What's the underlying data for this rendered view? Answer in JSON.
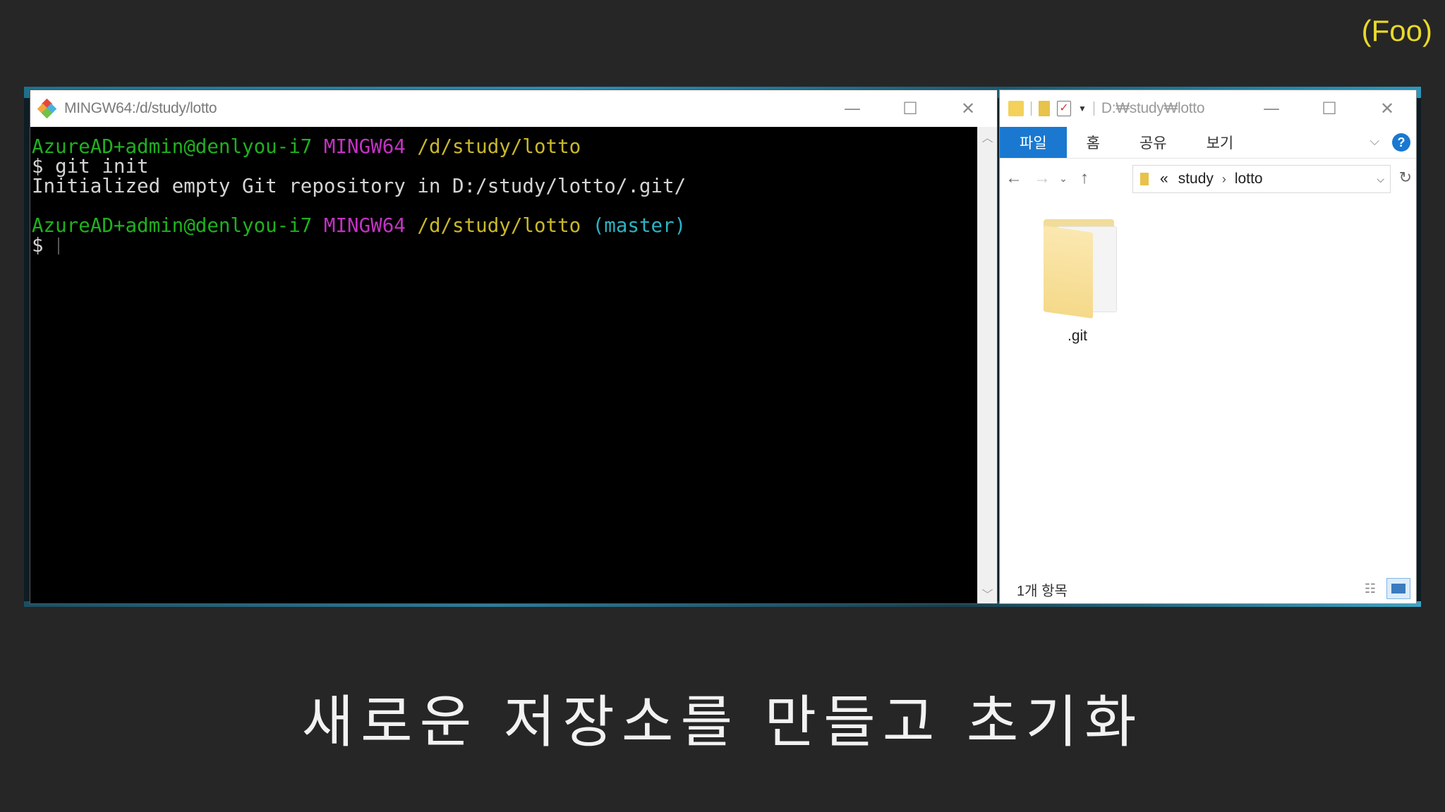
{
  "corner_tag": "(Foo)",
  "subtitle": "새로운 저장소를 만들고 초기화",
  "terminal": {
    "title": "MINGW64:/d/study/lotto",
    "lines": [
      {
        "user": "AzureAD+admin@denlyou-i7",
        "shell": "MINGW64",
        "path": "/d/study/lotto",
        "branch": ""
      },
      {
        "text": "$ git init"
      },
      {
        "text": "Initialized empty Git repository in D:/study/lotto/.git/"
      },
      {
        "text": ""
      },
      {
        "user": "AzureAD+admin@denlyou-i7",
        "shell": "MINGW64",
        "path": "/d/study/lotto",
        "branch": "(master)"
      },
      {
        "text": "$ "
      }
    ],
    "window_controls": {
      "minimize": "—",
      "maximize": "☐",
      "close": "✕"
    }
  },
  "explorer": {
    "title": "D:₩study₩lotto",
    "ribbon_tabs": [
      "파일",
      "홈",
      "공유",
      "보기"
    ],
    "active_tab": "파일",
    "help": "?",
    "address": {
      "overflow": "«",
      "crumbs": [
        "study",
        "lotto"
      ]
    },
    "items": [
      {
        "name": ".git",
        "type": "folder",
        "icon": "folder-icon"
      }
    ],
    "status": "1개 항목",
    "window_controls": {
      "minimize": "—",
      "maximize": "☐",
      "close": "✕"
    }
  }
}
